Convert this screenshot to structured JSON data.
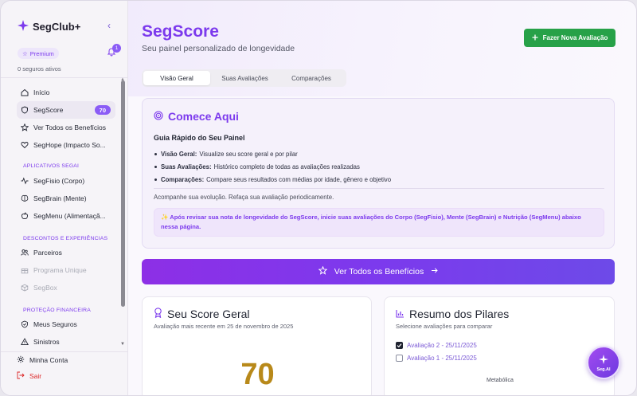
{
  "sidebar": {
    "brand": "SegClub+",
    "premium_label": "Premium",
    "notifications_count": "1",
    "seguros_ativos": "0 seguros ativos",
    "items": [
      {
        "label": "Início",
        "icon": "home-icon"
      },
      {
        "label": "SegScore",
        "icon": "shield-icon",
        "badge": "70",
        "active": true
      },
      {
        "label": "Ver Todos os Benefícios",
        "icon": "star-icon"
      },
      {
        "label": "SegHope (Impacto So...",
        "icon": "heart-icon"
      }
    ],
    "section_apps": "APLICATIVOS SEGAI",
    "apps": [
      {
        "label": "SegFisio (Corpo)",
        "icon": "activity-icon"
      },
      {
        "label": "SegBrain (Mente)",
        "icon": "brain-icon"
      },
      {
        "label": "SegMenu (Alimentaçã...",
        "icon": "apple-icon"
      }
    ],
    "section_discounts": "DESCONTOS E EXPERIÊNCIAS",
    "discounts": [
      {
        "label": "Parceiros",
        "icon": "users-icon"
      },
      {
        "label": "Programa Unique",
        "icon": "gift-icon",
        "disabled": true
      },
      {
        "label": "SegBox",
        "icon": "box-icon",
        "disabled": true
      }
    ],
    "section_protection": "PROTEÇÃO FINANCEIRA",
    "protection": [
      {
        "label": "Meus Seguros",
        "icon": "shield-check-icon"
      },
      {
        "label": "Sinistros",
        "icon": "alert-icon"
      }
    ],
    "account_label": "Minha Conta",
    "logout_label": "Sair"
  },
  "header": {
    "title": "SegScore",
    "subtitle": "Seu painel personalizado de longevidade",
    "new_evaluation_button": "Fazer Nova Avaliação"
  },
  "tabs": [
    {
      "label": "Visão Geral",
      "active": true
    },
    {
      "label": "Suas Avaliações"
    },
    {
      "label": "Comparações"
    }
  ],
  "start": {
    "title": "Comece Aqui",
    "guide_title": "Guia Rápido do Seu Painel",
    "items": [
      {
        "term": "Visão Geral:",
        "text": "Visualize seu score geral e por pilar"
      },
      {
        "term": "Suas Avaliações:",
        "text": "Histórico completo de todas as avaliações realizadas"
      },
      {
        "term": "Comparações:",
        "text": "Compare seus resultados com médias por idade, gênero e objetivo"
      }
    ],
    "follow_text": "Acompanhe sua evolução. Refaça sua avaliação periodicamente.",
    "notice": "✨ Após revisar sua nota de longevidade do SegScore, inicie suas avaliações do Corpo (SegFisio), Mente (SegBrain) e Nutrição (SegMenu) abaixo nessa página."
  },
  "benefits_button": "Ver Todos os Benefícios",
  "score_card": {
    "title": "Seu Score Geral",
    "subtitle": "Avaliação mais recente em 25 de novembro de 2025",
    "value": "70"
  },
  "pillars_card": {
    "title": "Resumo dos Pilares",
    "subtitle": "Selecione avaliações para comparar",
    "evaluations": [
      {
        "label": "Avaliação 2 - 25/11/2025",
        "checked": true
      },
      {
        "label": "Avaliação 1 - 25/11/2025",
        "checked": false
      }
    ],
    "axis_label": "Metabólica"
  },
  "fab_label": "Seg.AI",
  "colors": {
    "accent": "#7c3aed",
    "success": "#27a148",
    "score": "#b8891a",
    "danger": "#dc2626"
  }
}
